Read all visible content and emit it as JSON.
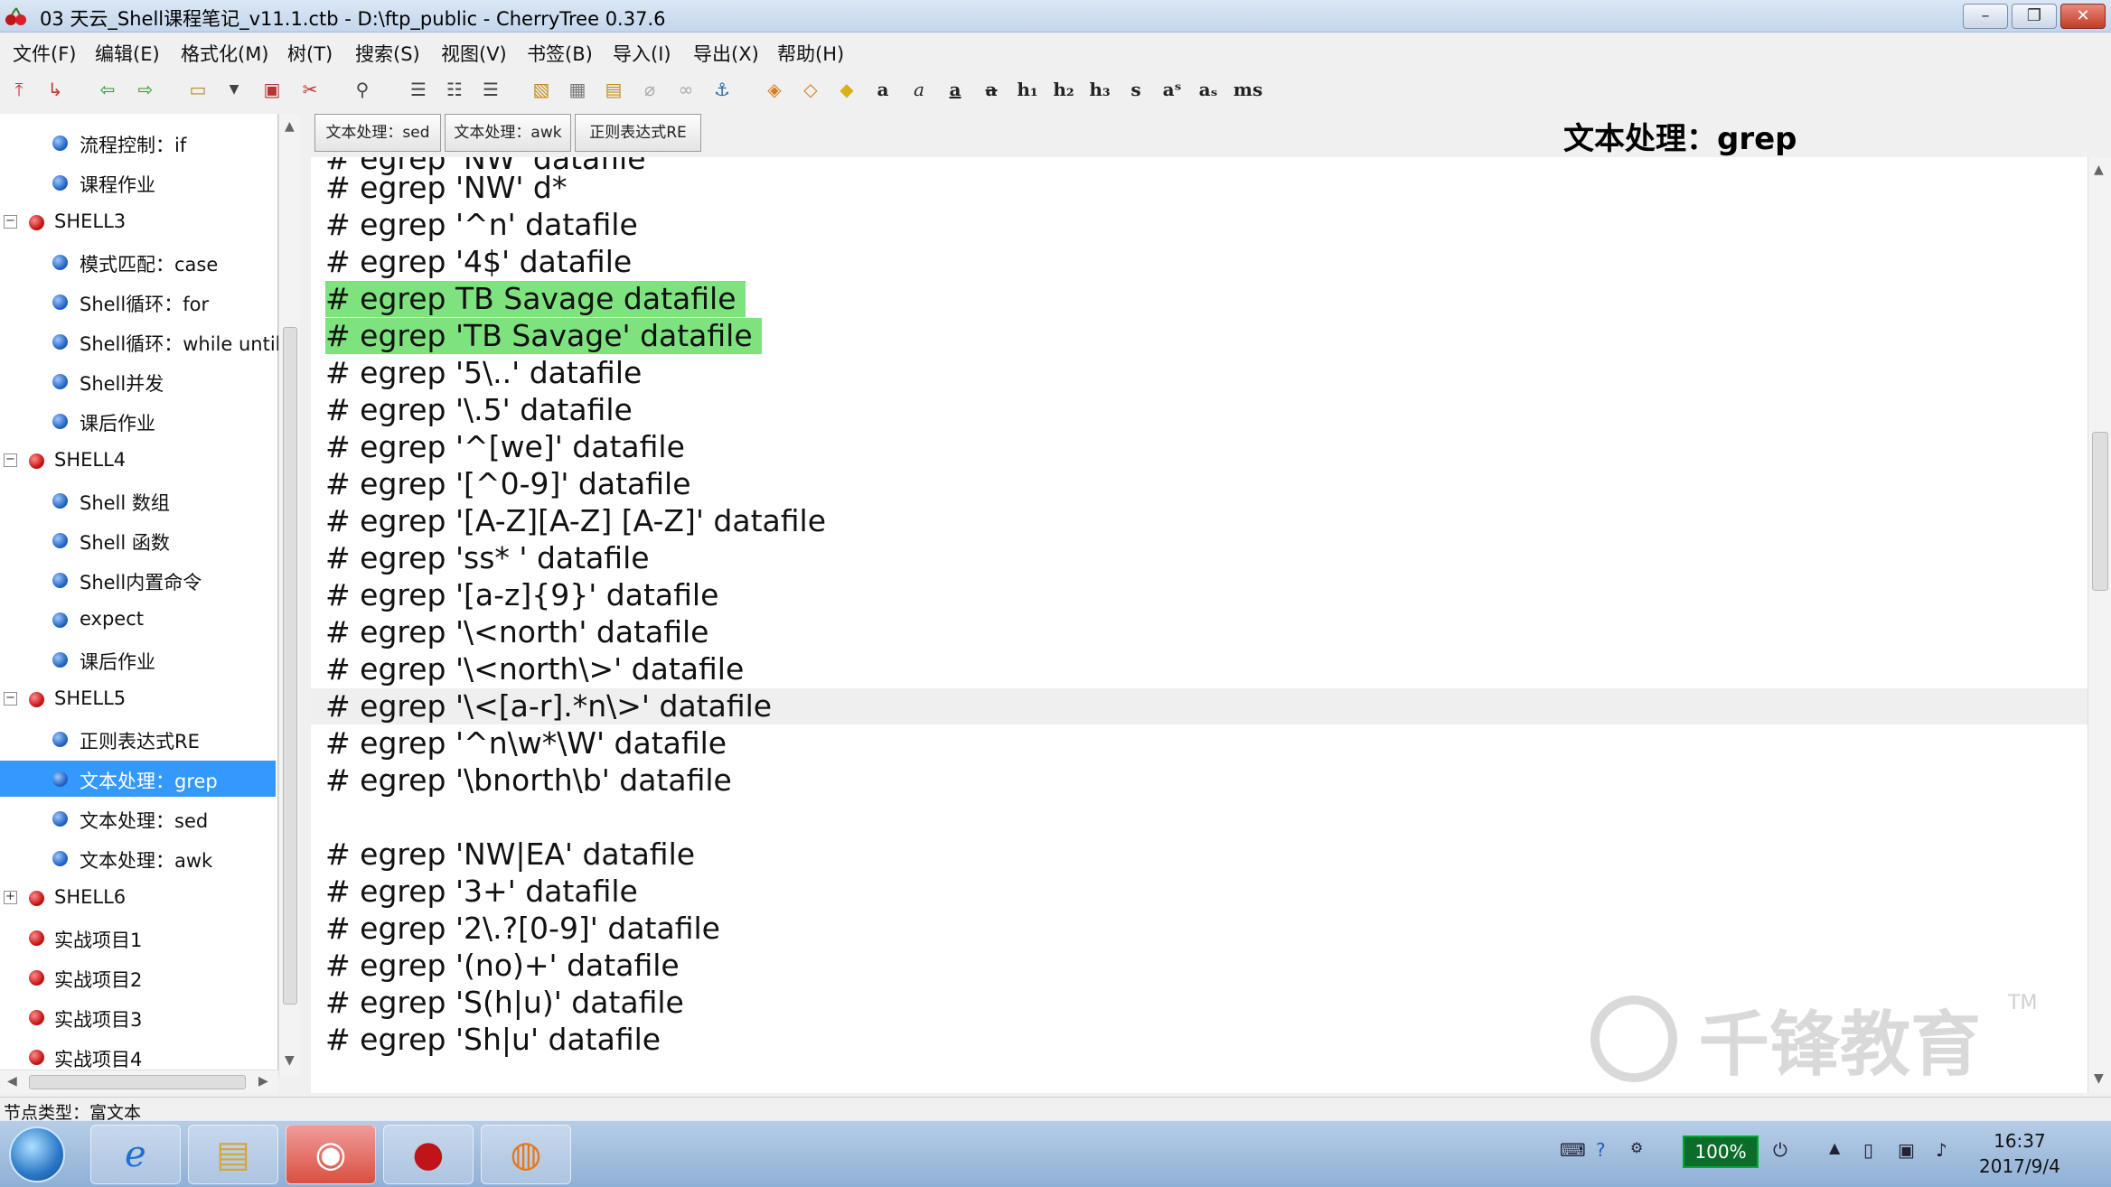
{
  "window": {
    "title": "03 天云_Shell课程笔记_v11.1.ctb - D:\\ftp_public - CherryTree 0.37.6",
    "controls": [
      "–",
      "❐",
      "✕"
    ]
  },
  "menu": [
    "文件(F)",
    "编辑(E)",
    "格式化(M)",
    "树(T)",
    "搜索(S)",
    "视图(V)",
    "书签(B)",
    "导入(I)",
    "导出(X)",
    "帮助(H)"
  ],
  "toolbar": {
    "format_labels": [
      "a",
      "a",
      "a",
      "a",
      "h₁",
      "h₂",
      "h₃",
      "s",
      "aˢ",
      "aₛ",
      "ms"
    ]
  },
  "tree": {
    "items": [
      {
        "label": "流程控制：if",
        "level": 2,
        "type": "leaf"
      },
      {
        "label": "课程作业",
        "level": 2,
        "type": "leaf"
      },
      {
        "label": "SHELL3",
        "level": 1,
        "type": "group",
        "expander": "−"
      },
      {
        "label": "模式匹配：case",
        "level": 2,
        "type": "leaf"
      },
      {
        "label": "Shell循环：for",
        "level": 2,
        "type": "leaf"
      },
      {
        "label": "Shell循环：while until",
        "level": 2,
        "type": "leaf"
      },
      {
        "label": "Shell并发",
        "level": 2,
        "type": "leaf"
      },
      {
        "label": "课后作业",
        "level": 2,
        "type": "leaf"
      },
      {
        "label": "SHELL4",
        "level": 1,
        "type": "group",
        "expander": "−"
      },
      {
        "label": "Shell 数组",
        "level": 2,
        "type": "leaf"
      },
      {
        "label": "Shell 函数",
        "level": 2,
        "type": "leaf"
      },
      {
        "label": "Shell内置命令",
        "level": 2,
        "type": "leaf"
      },
      {
        "label": "expect",
        "level": 2,
        "type": "leaf"
      },
      {
        "label": "课后作业",
        "level": 2,
        "type": "leaf"
      },
      {
        "label": "SHELL5",
        "level": 1,
        "type": "group",
        "expander": "−"
      },
      {
        "label": "正则表达式RE",
        "level": 2,
        "type": "leaf"
      },
      {
        "label": "文本处理：grep",
        "level": 2,
        "type": "leaf",
        "selected": true
      },
      {
        "label": "文本处理：sed",
        "level": 2,
        "type": "leaf"
      },
      {
        "label": "文本处理：awk",
        "level": 2,
        "type": "leaf"
      },
      {
        "label": "SHELL6",
        "level": 1,
        "type": "group",
        "expander": "+"
      },
      {
        "label": "实战项目1",
        "level": 1,
        "type": "leaf"
      },
      {
        "label": "实战项目2",
        "level": 1,
        "type": "leaf"
      },
      {
        "label": "实战项目3",
        "level": 1,
        "type": "leaf"
      },
      {
        "label": "实战项目4",
        "level": 1,
        "type": "leaf"
      }
    ]
  },
  "tabs": [
    "文本处理：sed",
    "文本处理：awk",
    "正则表达式RE"
  ],
  "node_title": "文本处理：grep",
  "editor": {
    "partial_top_line": "# egrep 'NW' datafile",
    "lines": [
      "# egrep 'NW' d*",
      "# egrep '^n' datafile",
      "# egrep '4$' datafile",
      "# egrep TB Savage datafile",
      "# egrep 'TB Savage' datafile",
      "# egrep '5\\..' datafile",
      "# egrep '\\.5' datafile",
      "# egrep '^[we]' datafile",
      "# egrep '[^0-9]' datafile",
      "# egrep '[A-Z][A-Z] [A-Z]' datafile",
      "# egrep 'ss* ' datafile",
      "# egrep '[a-z]{9}' datafile",
      "# egrep '\\<north' datafile",
      "# egrep '\\<north\\>' datafile",
      "# egrep '\\<[a-r].*n\\>' datafile",
      "# egrep '^n\\w*\\W' datafile",
      "# egrep '\\bnorth\\b' datafile",
      "",
      "# egrep 'NW|EA' datafile",
      "# egrep '3+' datafile",
      "# egrep '2\\.?[0-9]' datafile",
      "# egrep '(no)+' datafile",
      "# egrep 'S(h|u)' datafile",
      "# egrep 'Sh|u' datafile"
    ]
  },
  "watermark": {
    "text": "千锋教育",
    "tm": "TM"
  },
  "status": "节点类型：富文本",
  "taskbar": {
    "battery": "100%",
    "time": "16:37",
    "date": "2017/9/4"
  },
  "colors": {
    "highlight": "#7ee37e",
    "selection": "#3399ff",
    "regex_red": "#e01e1e"
  }
}
